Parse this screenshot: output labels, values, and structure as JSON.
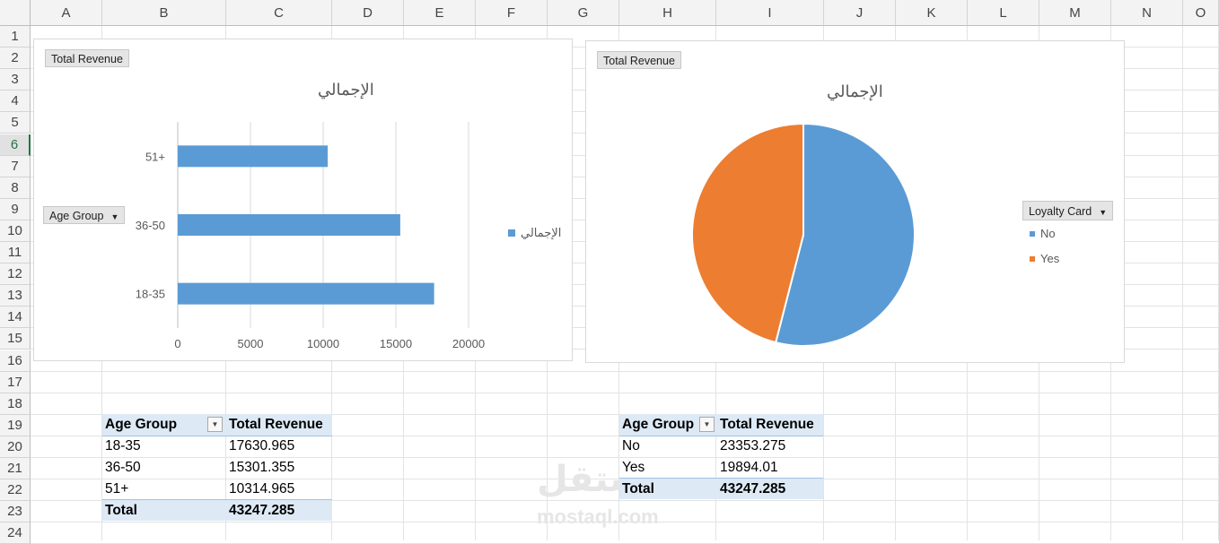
{
  "columns": [
    "A",
    "B",
    "C",
    "D",
    "E",
    "F",
    "G",
    "H",
    "I",
    "J",
    "K",
    "L",
    "M",
    "N",
    "O"
  ],
  "rows": [
    "1",
    "2",
    "3",
    "4",
    "5",
    "6",
    "7",
    "8",
    "9",
    "10",
    "11",
    "12",
    "13",
    "14",
    "15",
    "16",
    "17",
    "18",
    "19",
    "20",
    "21",
    "22",
    "23",
    "24"
  ],
  "bar_chart": {
    "field_button": "Total Revenue",
    "axis_button": "Age Group",
    "legend": "الإجمالي",
    "chart_data": {
      "type": "bar",
      "title": "الإجمالي",
      "categories": [
        "18-35",
        "36-50",
        "51+"
      ],
      "series": [
        {
          "name": "الإجمالي",
          "values": [
            17630.965,
            15301.355,
            10314.965
          ]
        }
      ],
      "xlim": [
        0,
        20000
      ],
      "xticks": [
        "0",
        "5000",
        "10000",
        "15000",
        "20000"
      ],
      "grid": true,
      "legend_position": "right",
      "color": "#5b9bd5"
    }
  },
  "pie_chart": {
    "field_button": "Total Revenue",
    "legend_button": "Loyalty Card",
    "chart_data": {
      "type": "pie",
      "title": "الإجمالي",
      "labels": [
        "No",
        "Yes"
      ],
      "values": [
        23353.275,
        19894.01
      ],
      "colors": [
        "#5b9bd5",
        "#ed7d31"
      ],
      "legend_position": "right"
    }
  },
  "pivot1": {
    "headers": [
      "Age Group",
      "Total Revenue"
    ],
    "rows": [
      [
        "18-35",
        "17630.965"
      ],
      [
        "36-50",
        "15301.355"
      ],
      [
        "51+",
        "10314.965"
      ]
    ],
    "total": [
      "Total",
      "43247.285"
    ]
  },
  "pivot2": {
    "headers": [
      "Age Group",
      "Total Revenue"
    ],
    "rows": [
      [
        "No",
        "23353.275"
      ],
      [
        "Yes",
        "19894.01"
      ]
    ],
    "total": [
      "Total",
      "43247.285"
    ]
  },
  "watermark": {
    "line1": "مستقل",
    "line2": "mostaql.com"
  }
}
